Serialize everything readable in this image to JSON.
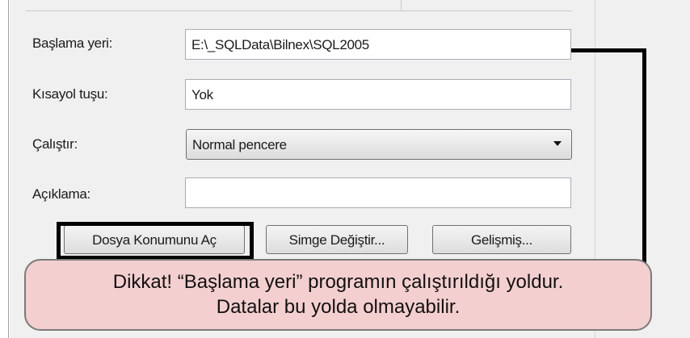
{
  "form": {
    "start_in": {
      "label": "Başlama yeri:",
      "value": "E:\\_SQLData\\Bilnex\\SQL2005"
    },
    "shortcut_key": {
      "label": "Kısayol tuşu:",
      "value": "Yok"
    },
    "run": {
      "label": "Çalıştır:",
      "selected": "Normal pencere"
    },
    "comment": {
      "label": "Açıklama:",
      "value": ""
    }
  },
  "buttons": {
    "open_location": "Dosya Konumunu Aç",
    "change_icon": "Simge Değiştir...",
    "advanced": "Gelişmiş..."
  },
  "callout": {
    "line1": "Dikkat! “Başlama yeri” programın çalıştırıldığı yoldur.",
    "line2": "Datalar bu yolda olmayabilir."
  },
  "colors": {
    "callout_bg": "#f4cfcf",
    "highlight": "#000000",
    "dialog_bg": "#f0f0f0"
  }
}
